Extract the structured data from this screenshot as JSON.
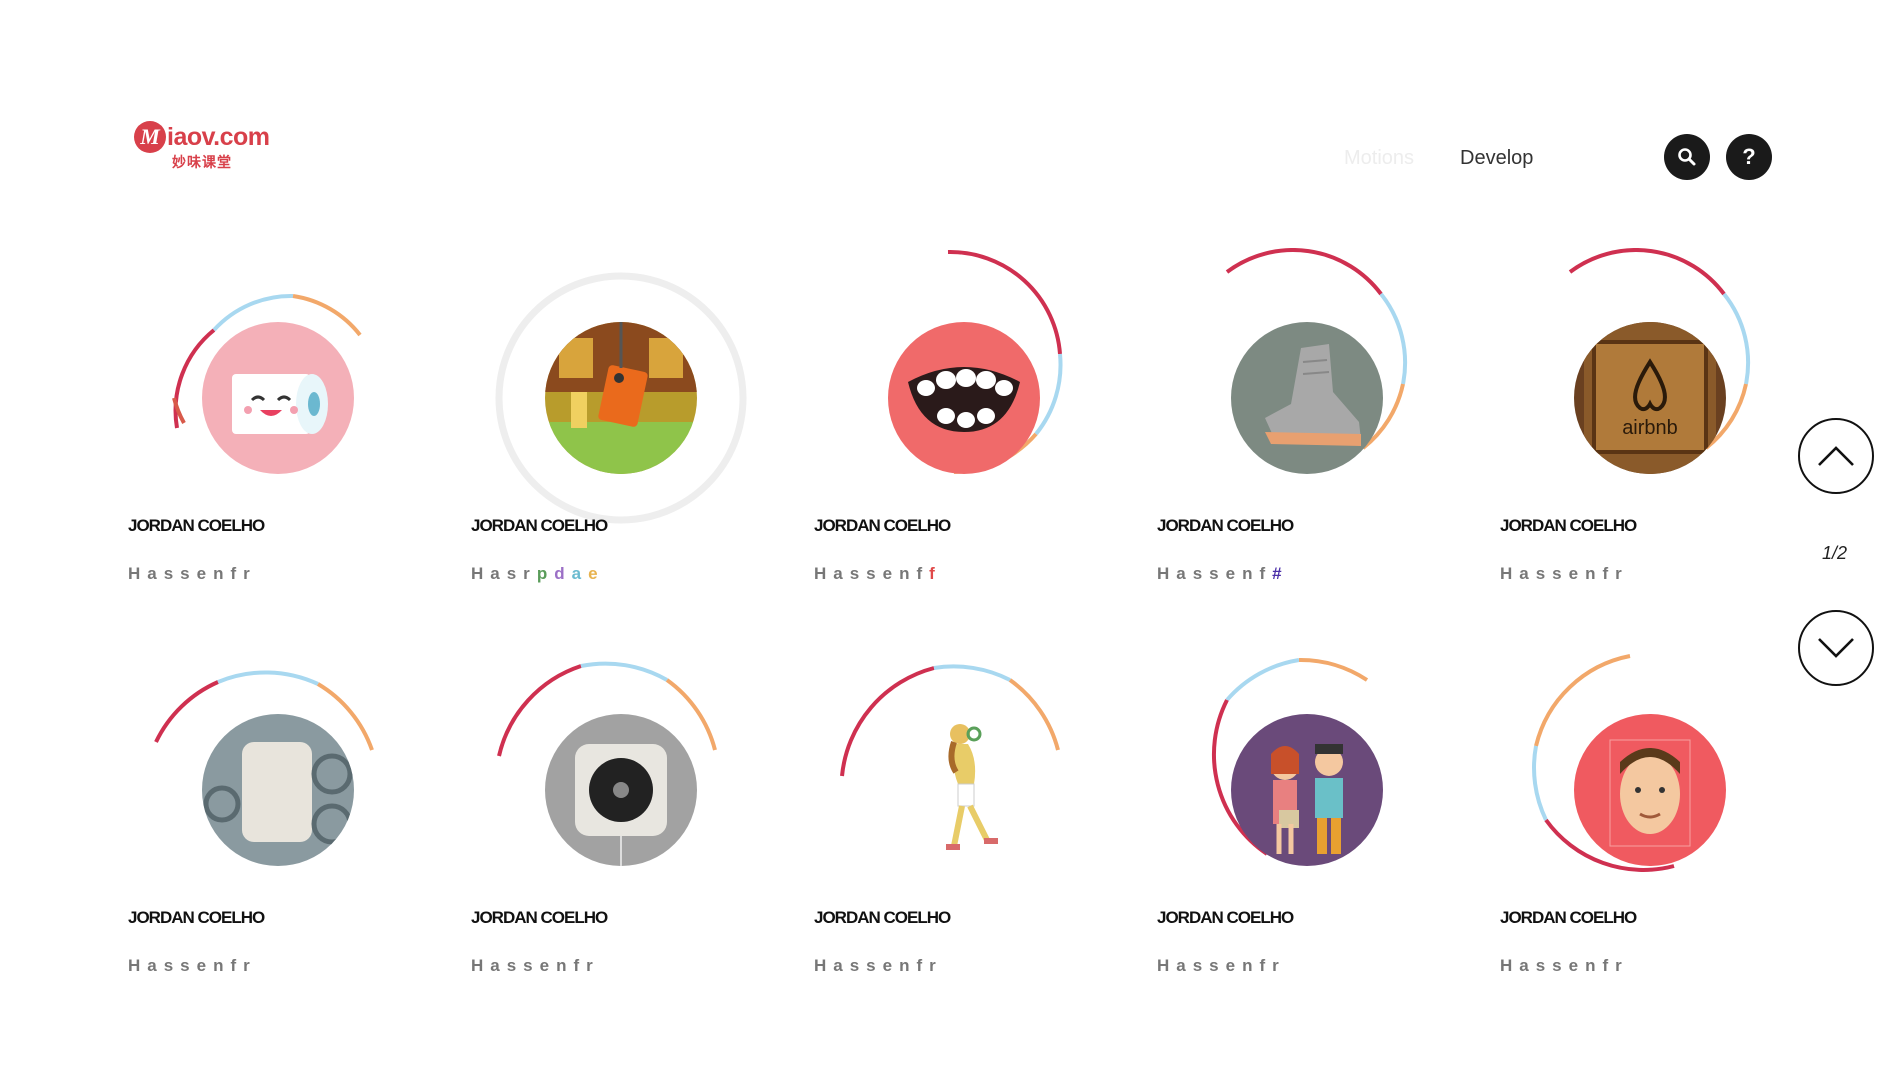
{
  "logo": {
    "brand": "iaov.com",
    "letter": "M",
    "subtitle": "妙味课堂"
  },
  "nav": {
    "motions": "Motions",
    "develop": "Develop"
  },
  "buttons": {
    "search_icon": "search-icon",
    "help_label": "?"
  },
  "pagination": {
    "indicator": "1/2"
  },
  "colors": {
    "ring_red": "#cf3050",
    "ring_blue": "#a8d8f0",
    "ring_orange": "#f2a86a",
    "accent": "#d8404a"
  },
  "cards": [
    {
      "name": "JORDAN COELHO",
      "sub": "Hassenfr",
      "icon": "toilet-roll-illustration"
    },
    {
      "name": "JORDAN COELHO",
      "sub_parts": [
        "Hasr",
        "p",
        "d",
        "a",
        "e"
      ],
      "icon": "robot-illustration"
    },
    {
      "name": "JORDAN COELHO",
      "sub_parts": [
        "Hassenf",
        "f"
      ],
      "icon": "mouth-illustration"
    },
    {
      "name": "JORDAN COELHO",
      "sub_parts": [
        "Hassenf",
        "#"
      ],
      "icon": "boot-illustration"
    },
    {
      "name": "JORDAN COELHO",
      "sub": "Hassenfr",
      "icon": "airbnb-photo"
    },
    {
      "name": "JORDAN COELHO",
      "sub": "Hassenfr",
      "icon": "tesla-battery-photo"
    },
    {
      "name": "JORDAN COELHO",
      "sub": "Hassenfr",
      "icon": "cd-player-photo"
    },
    {
      "name": "JORDAN COELHO",
      "sub": "Hassenfr",
      "icon": "walking-man-illustration"
    },
    {
      "name": "JORDAN COELHO",
      "sub": "Hassenfr",
      "icon": "couple-illustration"
    },
    {
      "name": "JORDAN COELHO",
      "sub": "Hassenfr",
      "icon": "face-illustration"
    }
  ],
  "airbnb_text": "airbnb"
}
